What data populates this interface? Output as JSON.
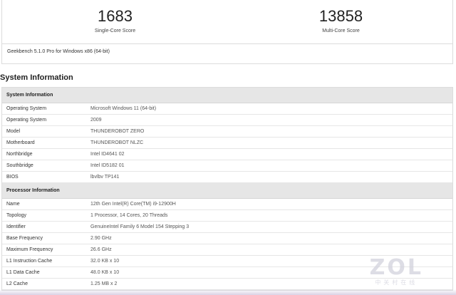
{
  "scores": {
    "single": {
      "value": "1683",
      "label": "Single-Core Score"
    },
    "multi": {
      "value": "13858",
      "label": "Multi-Core Score"
    }
  },
  "version": "Geekbench 5.1.0 Pro for Windows x86 (64-bit)",
  "section_title": "System Information",
  "system": {
    "heading": "System Information",
    "rows": [
      {
        "key": "Operating System",
        "value": "Microsoft Windows 11 (64-bit)"
      },
      {
        "key": "Operating System",
        "value": "2009"
      },
      {
        "key": "Model",
        "value": "THUNDEROBOT ZERO"
      },
      {
        "key": "Motherboard",
        "value": "THUNDEROBOT NLZC"
      },
      {
        "key": "Northbridge",
        "value": "Intel ID4641 02"
      },
      {
        "key": "Southbridge",
        "value": "Intel ID5182 01"
      },
      {
        "key": "BIOS",
        "value": "lbvlbv TP141"
      }
    ]
  },
  "processor": {
    "heading": "Processor Information",
    "rows": [
      {
        "key": "Name",
        "value": "12th Gen Intel(R) Core(TM) i9-12900H"
      },
      {
        "key": "Topology",
        "value": "1 Processor, 14 Cores, 20 Threads"
      },
      {
        "key": "Identifier",
        "value": "GenuineIntel Family 6 Model 154 Stepping 3"
      },
      {
        "key": "Base Frequency",
        "value": "2.90 GHz"
      },
      {
        "key": "Maximum Frequency",
        "value": "26.6 GHz"
      },
      {
        "key": "L1 Instruction Cache",
        "value": "32.0 KB x 10"
      },
      {
        "key": "L1 Data Cache",
        "value": "48.0 KB x 10"
      },
      {
        "key": "L2 Cache",
        "value": "1.25 MB x 2"
      }
    ]
  },
  "watermark": {
    "logo": "ZOL",
    "sub": "中关村在线"
  }
}
